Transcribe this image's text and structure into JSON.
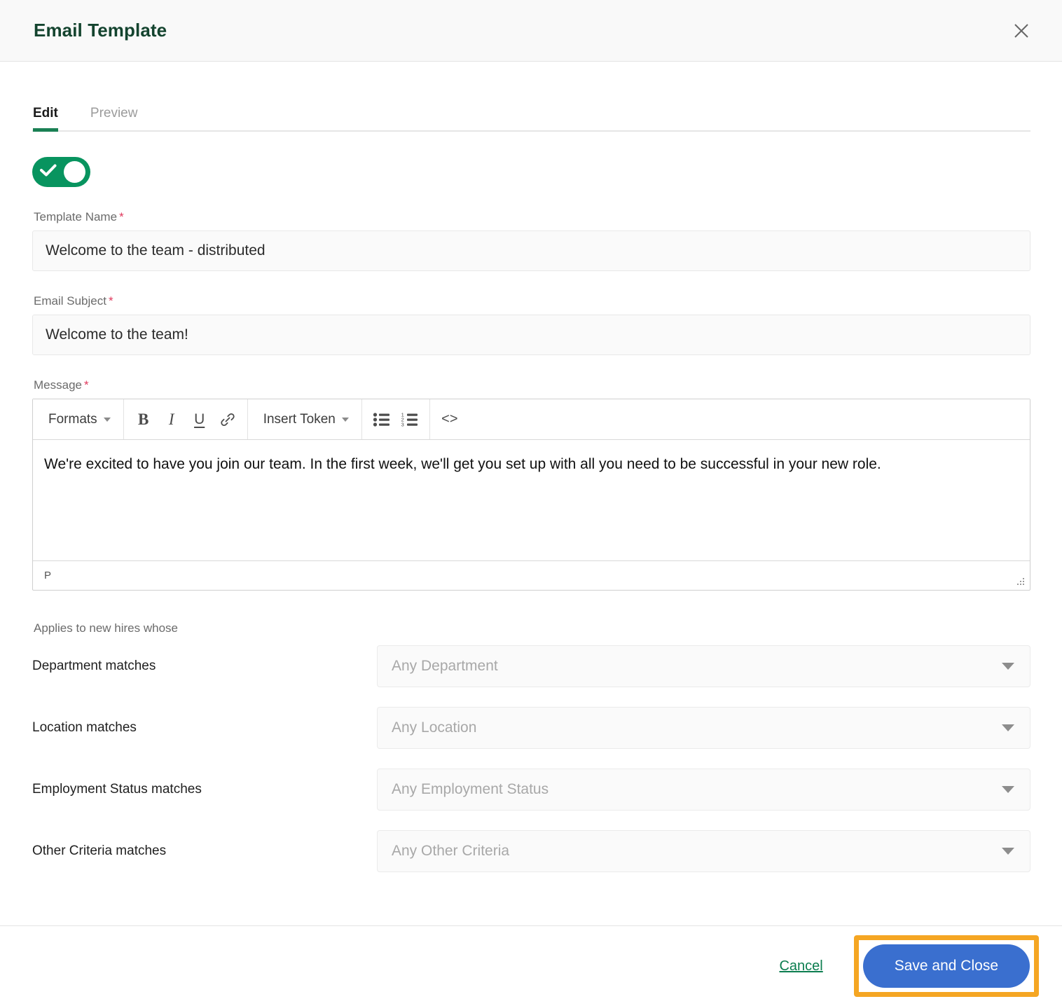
{
  "header": {
    "title": "Email Template",
    "close_icon": "close-icon"
  },
  "tabs": [
    {
      "label": "Edit",
      "active": true
    },
    {
      "label": "Preview",
      "active": false
    }
  ],
  "toggle": {
    "name": "template-enabled-toggle",
    "state": "on",
    "color": "#08945f"
  },
  "fields": {
    "template_name": {
      "label": "Template Name",
      "required_marker": "*",
      "value": "Welcome to the team - distributed"
    },
    "email_subject": {
      "label": "Email Subject",
      "required_marker": "*",
      "value": "Welcome to the team!"
    },
    "message": {
      "label": "Message",
      "required_marker": "*",
      "body": "We're excited to have you join our team. In the first week, we'll get you set up with all you need to be successful in your new role.",
      "status_path": "P"
    }
  },
  "toolbar": {
    "formats_label": "Formats",
    "bold_label": "B",
    "italic_label": "I",
    "underline_label": "U",
    "link_icon": "link-icon",
    "insert_token_label": "Insert Token",
    "bullet_list_icon": "bullet-list-icon",
    "numbered_list_icon": "numbered-list-icon",
    "source_code_label": "<>"
  },
  "criteria": {
    "heading": "Applies to new hires whose",
    "rows": [
      {
        "label": "Department matches",
        "placeholder": "Any Department"
      },
      {
        "label": "Location matches",
        "placeholder": "Any Location"
      },
      {
        "label": "Employment Status matches",
        "placeholder": "Any Employment Status"
      },
      {
        "label": "Other Criteria matches",
        "placeholder": "Any Other Criteria"
      }
    ]
  },
  "footer": {
    "cancel_label": "Cancel",
    "save_label": "Save and Close",
    "save_color": "#3a6fcf",
    "highlight_color": "#f5a623",
    "cancel_color": "#0b7d4f"
  }
}
